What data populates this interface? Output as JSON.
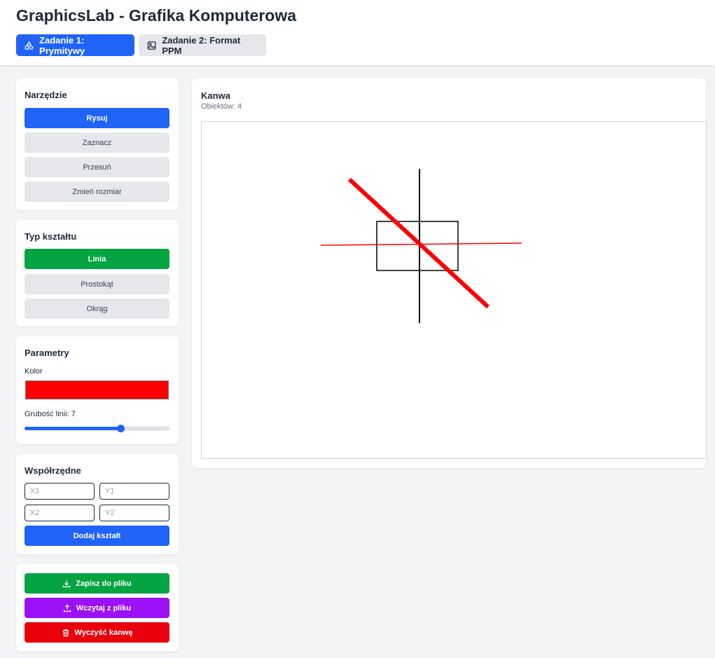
{
  "header": {
    "title": "GraphicsLab - Grafika Komputerowa",
    "tabs": [
      {
        "label": "Zadanie 1: Prymitywy",
        "icon": "shapes-icon",
        "active": true
      },
      {
        "label": "Zadanie 2: Format PPM",
        "icon": "image-icon",
        "active": false
      }
    ]
  },
  "tool_panel": {
    "title": "Narzędzie",
    "items": [
      {
        "label": "Rysuj",
        "active": true
      },
      {
        "label": "Zaznacz",
        "active": false
      },
      {
        "label": "Przesuń",
        "active": false
      },
      {
        "label": "Zmień rozmiar",
        "active": false
      }
    ]
  },
  "shape_panel": {
    "title": "Typ kształtu",
    "items": [
      {
        "label": "Linia",
        "active": true
      },
      {
        "label": "Prostokąt",
        "active": false
      },
      {
        "label": "Okrąg",
        "active": false
      }
    ]
  },
  "params_panel": {
    "title": "Parametry",
    "color_label": "Kolor",
    "color_value": "#ff0000",
    "thickness_label": "Grubość linii: 7",
    "thickness_fraction": 0.66
  },
  "coords_panel": {
    "title": "Współrzędne",
    "x1_placeholder": "X1",
    "y1_placeholder": "Y1",
    "x2_placeholder": "X2",
    "y2_placeholder": "Y2",
    "add_label": "Dodaj kształt"
  },
  "file_panel": {
    "save_label": "Zapisz do pliku",
    "load_label": "Wczytaj z pliku",
    "clear_label": "Wyczyść kanwę"
  },
  "canvas": {
    "title": "Kanwa",
    "count_label": "Obiektów: 4"
  },
  "colors": {
    "accent_blue": "#1f63f7",
    "green": "#05a443",
    "purple": "#9b11f5",
    "red": "#e8000b"
  }
}
